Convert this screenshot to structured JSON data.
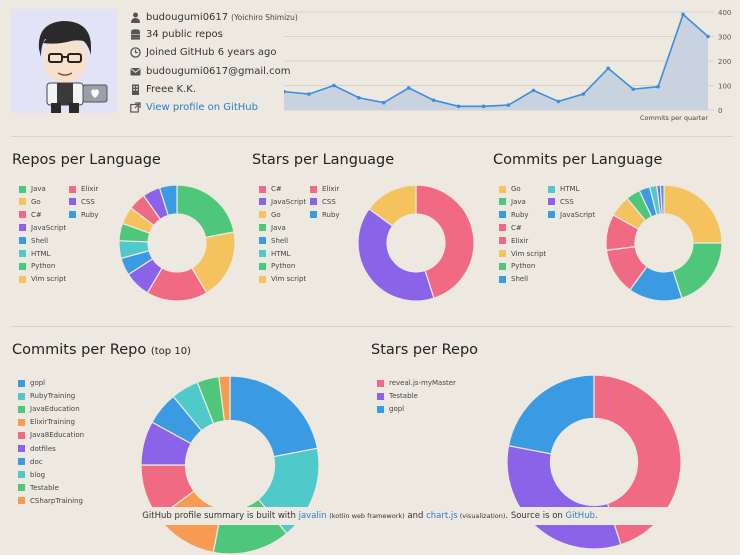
{
  "profile": {
    "username": "budougumi0617",
    "full_name": "(Yoichiro Shimizu)",
    "repos": "34 public repos",
    "joined": "Joined GitHub 6 years ago",
    "email": "budougumi0617@gmail.com",
    "company": "Freee K.K.",
    "profile_link": "View profile on GitHub"
  },
  "colors": {
    "green": "#4ec77b",
    "yellow": "#f4c35e",
    "red": "#f06a83",
    "purple": "#8a63e8",
    "teal": "#4fc9c9",
    "blue": "#3b9be2",
    "orange": "#f79a52",
    "lightblue": "#4fc0d8",
    "line": "#3a8fdc",
    "area": "#c9d3e0"
  },
  "chart_data": [
    {
      "type": "line",
      "title": "",
      "xlabel": "Commits per quarter",
      "ylabel": "",
      "ylim": [
        0,
        400
      ],
      "yticks": [
        "0",
        "100",
        "200",
        "300",
        "400"
      ],
      "x": [
        1,
        2,
        3,
        4,
        5,
        6,
        7,
        8,
        9,
        10,
        11,
        12,
        13,
        14,
        15,
        16,
        17
      ],
      "values": [
        75,
        65,
        100,
        50,
        30,
        90,
        40,
        15,
        15,
        20,
        80,
        35,
        65,
        170,
        85,
        95,
        390,
        300
      ]
    },
    {
      "type": "pie",
      "title": "Repos per Language",
      "labels": [
        "Java",
        "Go",
        "C#",
        "JavaScript",
        "Shell",
        "HTML",
        "Python",
        "Vim script",
        "Elixir",
        "CSS",
        "Ruby"
      ],
      "colors": [
        "#4ec77b",
        "#f4c35e",
        "#f06a83",
        "#8a63e8",
        "#3b9be2",
        "#4fc9c9",
        "#4ec77b",
        "#f4c35e",
        "#f06a83",
        "#8a63e8",
        "#3b9be2"
      ],
      "values": [
        9,
        8,
        7,
        3,
        2,
        2,
        2,
        2,
        2,
        2,
        2
      ]
    },
    {
      "type": "pie",
      "title": "Stars per Language",
      "labels": [
        "C#",
        "JavaScript",
        "Go",
        "Java",
        "Shell",
        "HTML",
        "Python",
        "Vim script",
        "Elixir",
        "CSS",
        "Ruby"
      ],
      "colors": [
        "#f06a83",
        "#8a63e8",
        "#f4c35e",
        "#4ec77b",
        "#3b9be2",
        "#4fc9c9",
        "#4ec77b",
        "#f4c35e",
        "#f06a83",
        "#8a63e8",
        "#3b9be2"
      ],
      "values": [
        45,
        40,
        15,
        0,
        0,
        0,
        0,
        0,
        0,
        0,
        0
      ]
    },
    {
      "type": "pie",
      "title": "Commits per Language",
      "labels": [
        "Go",
        "Java",
        "Ruby",
        "C#",
        "Elixir",
        "Vim script",
        "Python",
        "Shell",
        "HTML",
        "CSS",
        "JavaScript"
      ],
      "colors": [
        "#f4c35e",
        "#4ec77b",
        "#3b9be2",
        "#f06a83",
        "#f06a83",
        "#f4c35e",
        "#4ec77b",
        "#3b9be2",
        "#4fc9c9",
        "#8a63e8",
        "#3b9be2"
      ],
      "values": [
        25,
        20,
        15,
        13,
        10,
        6,
        4,
        3,
        2,
        1,
        1
      ]
    },
    {
      "type": "pie",
      "title": "Commits per Repo",
      "title_note": "(top 10)",
      "labels": [
        "gopl",
        "RubyTraining",
        "JavaEducation",
        "ElixirTraining",
        "Java8Education",
        "dotfiles",
        "doc",
        "blog",
        "Testable",
        "CSharpTraining"
      ],
      "colors": [
        "#3b9be2",
        "#4fc9c9",
        "#4ec77b",
        "#f79a52",
        "#f06a83",
        "#8a63e8",
        "#3b9be2",
        "#4fc9c9",
        "#4ec77b",
        "#f79a52"
      ],
      "values": [
        22,
        17,
        14,
        12,
        10,
        8,
        6,
        5,
        4,
        2
      ]
    },
    {
      "type": "pie",
      "title": "Stars per Repo",
      "labels": [
        "reveal.js-myMaster",
        "Testable",
        "gopl"
      ],
      "colors": [
        "#f06a83",
        "#8a63e8",
        "#3b9be2"
      ],
      "values": [
        45,
        33,
        22
      ]
    }
  ],
  "footer": {
    "t1": "GitHub profile summary is built with ",
    "javalin": "javalin",
    "t2": " (kotlin web framework)",
    "t3": " and ",
    "chartjs": "chart.js",
    "t4": " (visualization)",
    "t5": ". Source is on ",
    "github": "GitHub",
    "t6": "."
  }
}
